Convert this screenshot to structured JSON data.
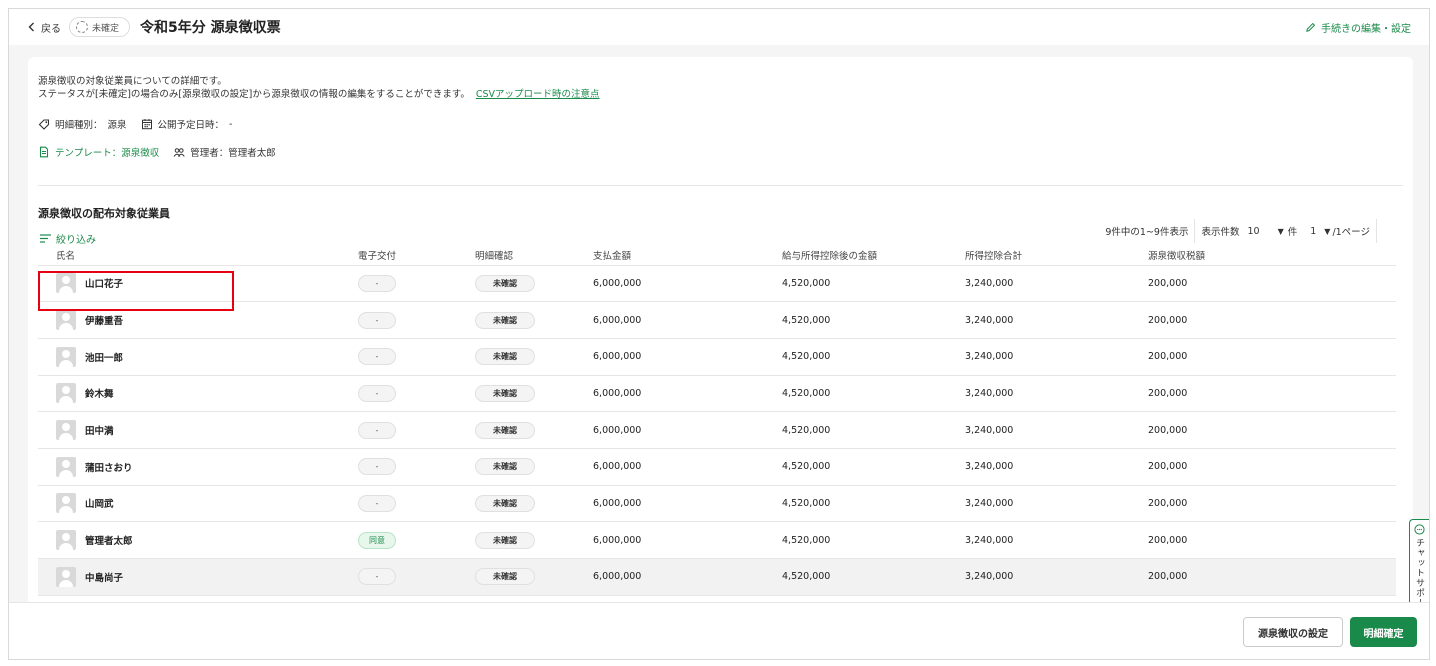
{
  "header": {
    "back_label": "戻る",
    "status_label": "未確定",
    "title": "令和5年分 源泉徴収票",
    "edit_link": "手続きの編集・設定"
  },
  "description": {
    "line1": "源泉徴収の対象従業員についての詳細です。",
    "line2": "ステータスが[未確定]の場合のみ[源泉徴収の設定]から源泉徴収の情報の編集をすることができます。",
    "csv_link": "CSVアップロード時の注意点"
  },
  "meta": {
    "type_label": "明細種別：",
    "type_value": "源泉",
    "publish_label": "公開予定日時：",
    "publish_value": "-",
    "template_label": "テンプレート：",
    "template_value": "源泉徴収",
    "admin_label": "管理者：",
    "admin_value": "管理者太郎"
  },
  "section": {
    "title": "源泉徴収の配布対象従業員",
    "filter_label": "絞り込み"
  },
  "pager": {
    "summary": "9件中の1~9件表示",
    "per_page_label": "表示件数",
    "per_page_value": "10",
    "per_page_unit": "件",
    "page_value": "1",
    "page_total": "/1ページ"
  },
  "table": {
    "columns": [
      "氏名",
      "電子交付",
      "明細確認",
      "支払金額",
      "給与所得控除後の金額",
      "所得控除合計",
      "源泉徴収税額"
    ],
    "rows": [
      {
        "name": "山口花子",
        "e_delivery": "-",
        "confirm": "未確認",
        "payment": "6,000,000",
        "after_deduction": "4,520,000",
        "deduction_total": "3,240,000",
        "tax": "200,000"
      },
      {
        "name": "伊藤重吾",
        "e_delivery": "-",
        "confirm": "未確認",
        "payment": "6,000,000",
        "after_deduction": "4,520,000",
        "deduction_total": "3,240,000",
        "tax": "200,000"
      },
      {
        "name": "池田一郎",
        "e_delivery": "-",
        "confirm": "未確認",
        "payment": "6,000,000",
        "after_deduction": "4,520,000",
        "deduction_total": "3,240,000",
        "tax": "200,000"
      },
      {
        "name": "鈴木舞",
        "e_delivery": "-",
        "confirm": "未確認",
        "payment": "6,000,000",
        "after_deduction": "4,520,000",
        "deduction_total": "3,240,000",
        "tax": "200,000"
      },
      {
        "name": "田中満",
        "e_delivery": "-",
        "confirm": "未確認",
        "payment": "6,000,000",
        "after_deduction": "4,520,000",
        "deduction_total": "3,240,000",
        "tax": "200,000"
      },
      {
        "name": "蒲田さおり",
        "e_delivery": "-",
        "confirm": "未確認",
        "payment": "6,000,000",
        "after_deduction": "4,520,000",
        "deduction_total": "3,240,000",
        "tax": "200,000"
      },
      {
        "name": "山岡武",
        "e_delivery": "-",
        "confirm": "未確認",
        "payment": "6,000,000",
        "after_deduction": "4,520,000",
        "deduction_total": "3,240,000",
        "tax": "200,000"
      },
      {
        "name": "管理者太郎",
        "e_delivery": "同意",
        "confirm": "未確認",
        "payment": "6,000,000",
        "after_deduction": "4,520,000",
        "deduction_total": "3,240,000",
        "tax": "200,000"
      },
      {
        "name": "中島尚子",
        "e_delivery": "-",
        "confirm": "未確認",
        "payment": "6,000,000",
        "after_deduction": "4,520,000",
        "deduction_total": "3,240,000",
        "tax": "200,000"
      }
    ]
  },
  "chat_support": "チャットサポート",
  "footer": {
    "settings_button": "源泉徴収の設定",
    "confirm_button": "明細確定"
  },
  "colors": {
    "accent": "#1a8a4a",
    "highlight": "#e60012"
  }
}
